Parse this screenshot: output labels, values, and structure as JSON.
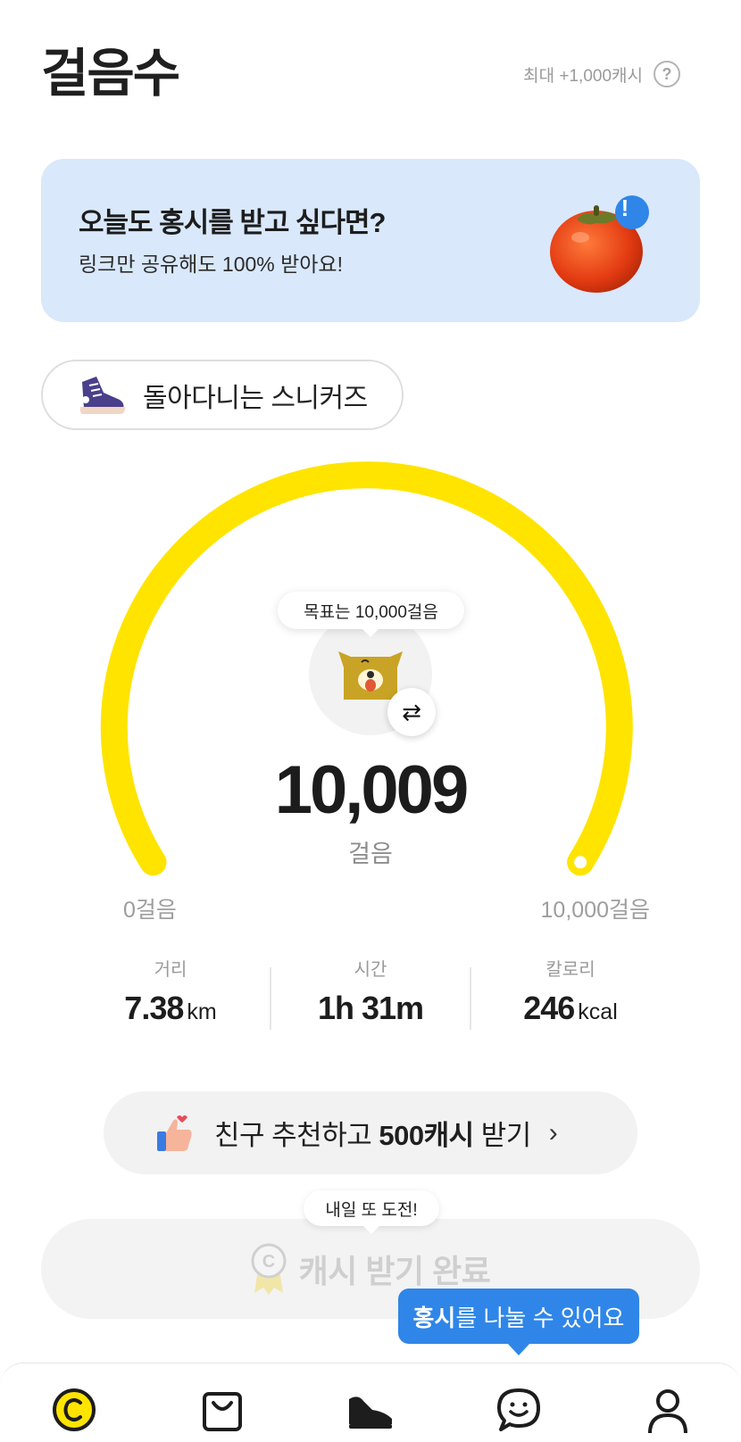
{
  "header": {
    "title": "걸음수",
    "max_reward": "최대 +1,000캐시",
    "help_glyph": "?"
  },
  "banner": {
    "title": "오늘도 홍시를 받고 싶다면?",
    "subtitle": "링크만 공유해도 100% 받아요!",
    "badge_glyph": "!"
  },
  "shoe": {
    "label": "돌아다니는 스니커즈"
  },
  "gauge": {
    "goal_bubble": "목표는 10,000걸음",
    "steps": "10,009",
    "unit": "걸음",
    "min_label": "0걸음",
    "max_label": "10,000걸음",
    "progress": 1.0,
    "color": "#FFE400",
    "swap_glyph": "⇄"
  },
  "stats": [
    {
      "label": "거리",
      "value": "7.38",
      "unit": "km"
    },
    {
      "label": "시간",
      "value": "1h 31m",
      "unit": ""
    },
    {
      "label": "칼로리",
      "value": "246",
      "unit": "kcal"
    }
  ],
  "invite": {
    "prefix": "친구 추천하고 ",
    "bold": "500캐시",
    "suffix": " 받기",
    "chevron": "›"
  },
  "tomorrow_bubble": "내일 또 도전!",
  "cash_button": {
    "label": "캐시 받기 완료"
  },
  "share_tooltip": {
    "bold": "홍시",
    "rest": "를 나눌 수 있어요",
    "color": "#2F86E8"
  },
  "nav": {
    "items": [
      "cash-coin-icon",
      "shopping-bag-icon",
      "sneaker-icon",
      "chat-smile-icon",
      "profile-icon"
    ]
  }
}
